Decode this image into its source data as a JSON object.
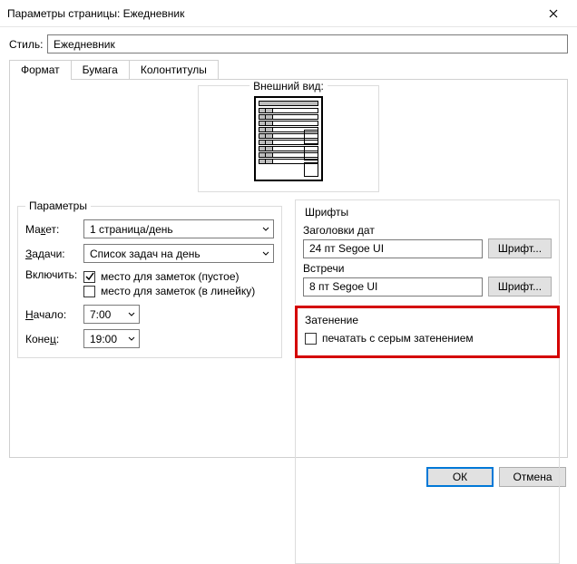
{
  "window": {
    "title": "Параметры страницы: Ежедневник"
  },
  "style": {
    "label": "Стиль:",
    "value": "Ежедневник"
  },
  "tabs": {
    "items": [
      {
        "label": "Формат",
        "active": true
      },
      {
        "label": "Бумага",
        "active": false
      },
      {
        "label": "Колонтитулы",
        "active": false
      }
    ]
  },
  "appearance": {
    "legend": "Внешний вид:"
  },
  "parameters": {
    "legend": "Параметры",
    "layout_label_pre": "Ма",
    "layout_label_ul": "к",
    "layout_label_post": "ет:",
    "layout_value": "1 страница/день",
    "tasks_label_ul": "З",
    "tasks_label_post": "адачи:",
    "tasks_value": "Список задач на день",
    "include_label": "Включить:",
    "include_notes_empty": "место для заметок (пустое)",
    "include_notes_lined": "место для заметок (в линейку)",
    "start_label_ul": "Н",
    "start_label_post": "ачало:",
    "start_value": "7:00",
    "end_label_pre": "Коне",
    "end_label_ul": "ц",
    "end_label_post": ":",
    "end_value": "19:00"
  },
  "fonts": {
    "legend": "Шрифты",
    "date_headers_label": "Заголовки дат",
    "date_headers_value": "24 пт Segoe UI",
    "appointments_label": "Встречи",
    "appointments_value": "8 пт Segoe UI",
    "font_button": "Шрифт..."
  },
  "shading": {
    "legend": "Затенение",
    "checkbox_label": "печатать с серым затенением"
  },
  "footer": {
    "ok": "ОК",
    "cancel": "Отмена"
  }
}
